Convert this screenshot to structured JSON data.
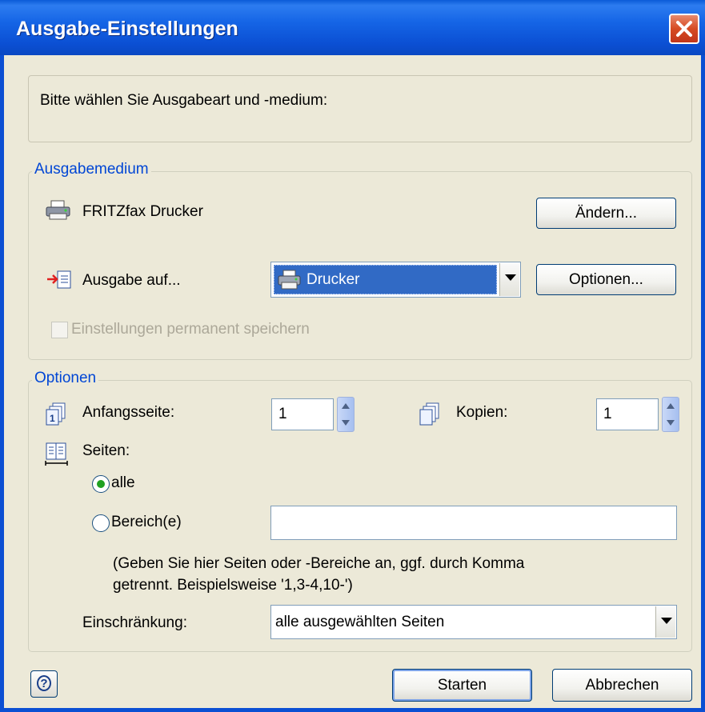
{
  "window": {
    "title": "Ausgabe-Einstellungen"
  },
  "intro": {
    "text": "Bitte wählen Sie Ausgabeart und -medium:"
  },
  "output_medium": {
    "legend": "Ausgabemedium",
    "printer_name": "FRITZfax Drucker",
    "change_label": "Ändern...",
    "output_to_label": "Ausgabe auf...",
    "output_to_value": "Drucker",
    "options_label": "Optionen...",
    "save_permanent_label": "Einstellungen permanent speichern"
  },
  "options": {
    "legend": "Optionen",
    "start_page_label": "Anfangsseite:",
    "start_page_value": "1",
    "copies_label": "Kopien:",
    "copies_value": "1",
    "pages_label": "Seiten:",
    "all_label": "alle",
    "range_label": "Bereich(e)",
    "range_value": "",
    "hint_line1": "(Geben Sie hier Seiten oder -Bereiche an, ggf. durch Komma",
    "hint_line2": "getrennt. Beispielsweise '1,3-4,10-')",
    "restriction_label": "Einschränkung:",
    "restriction_value": "alle ausgewählten Seiten"
  },
  "footer": {
    "start_label": "Starten",
    "cancel_label": "Abbrechen"
  }
}
